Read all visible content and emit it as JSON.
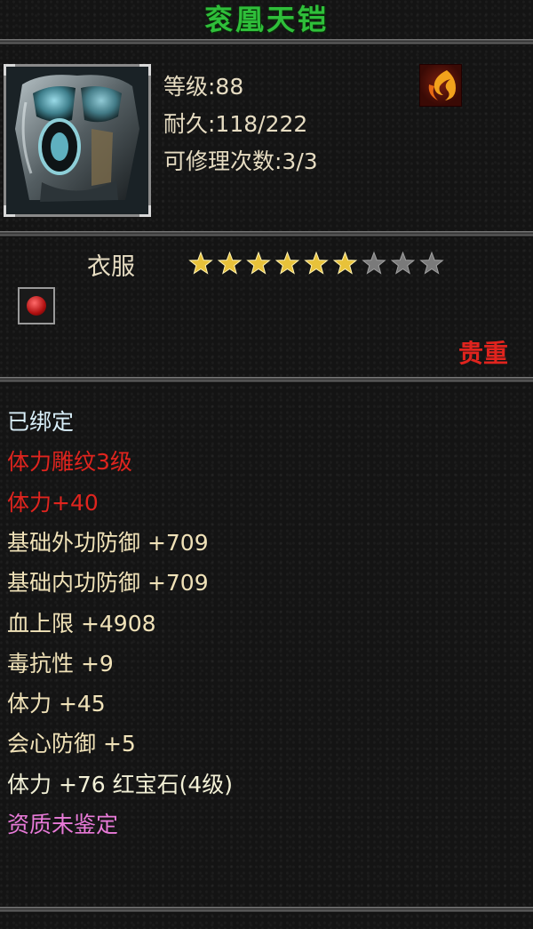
{
  "item": {
    "name": "衮凰天铠",
    "stats": {
      "level": "等级:88",
      "durability": "耐久:118/222",
      "repairs": "可修理次数:3/3"
    },
    "category": "衣服",
    "stars": {
      "filled": 6,
      "total": 9
    },
    "rarity": "贵重",
    "properties": [
      {
        "text": "已绑定",
        "color": "#d8eef8"
      },
      {
        "text": "体力雕纹3级",
        "color": "#e0241e"
      },
      {
        "text": "体力+40",
        "color": "#e0241e"
      },
      {
        "text": "基础外功防御  +709",
        "color": "#f0e2b8"
      },
      {
        "text": "基础内功防御  +709",
        "color": "#f0e2b8"
      },
      {
        "text": "血上限  +4908",
        "color": "#f0e2b8"
      },
      {
        "text": "毒抗性  +9",
        "color": "#f0e2b8"
      },
      {
        "text": "体力  +45",
        "color": "#f0e2b8"
      },
      {
        "text": "会心防御  +5",
        "color": "#f0e2b8"
      },
      {
        "text": "体力  +76  红宝石(4级)",
        "color": "#f2f0d6"
      },
      {
        "text": "资质未鉴定",
        "color": "#e87ad8"
      }
    ]
  },
  "icons": {
    "item": "armor-icon",
    "element": "fire-icon",
    "gem": "ruby-gem-icon",
    "star": "star-icon"
  },
  "colors": {
    "title": "#2fbf3a",
    "rarity": "#e0241e",
    "star_filled": "#e8c23a",
    "star_empty": "#7a7a7a"
  }
}
